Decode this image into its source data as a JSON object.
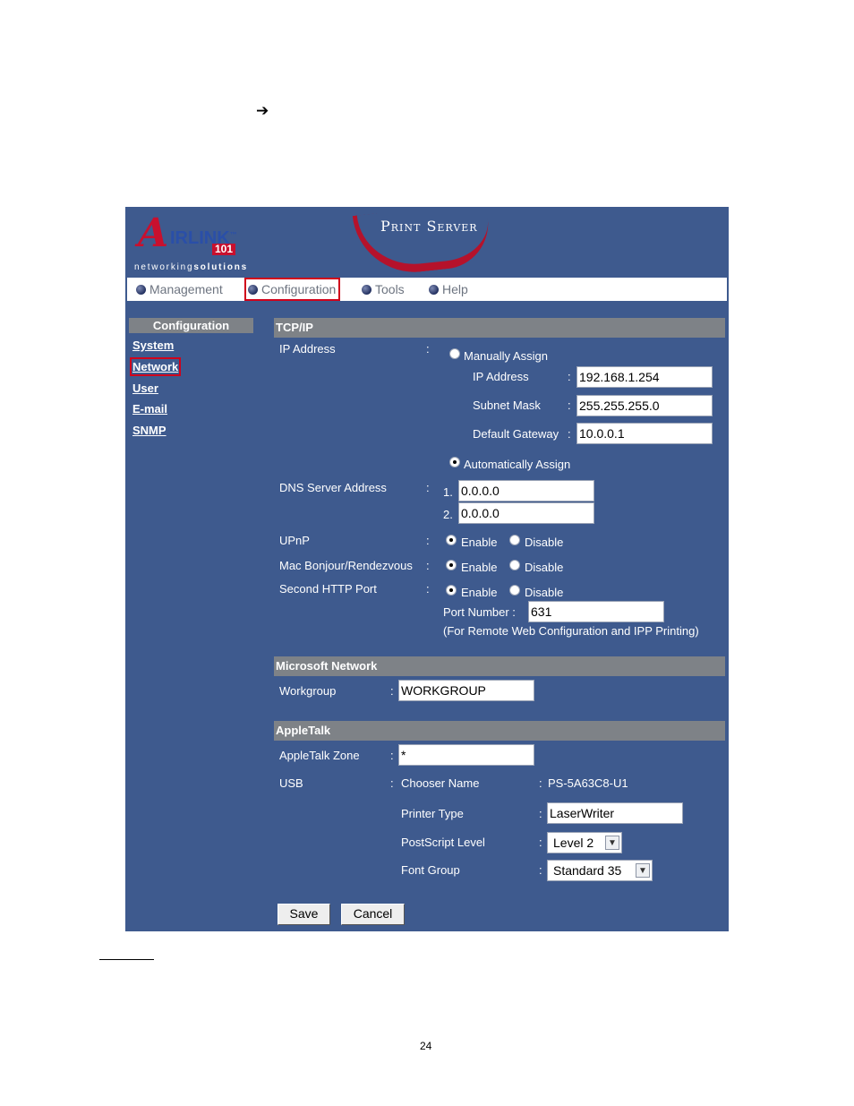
{
  "arrow": "➔",
  "brand": {
    "logo_a": "A",
    "logo_name": "IRLINK",
    "logo_tm": "™",
    "logo_num": "101",
    "tag_light": "networking",
    "tag_bold": "solutions",
    "product_title": "Print Server"
  },
  "nav": {
    "items": [
      {
        "label": "Management"
      },
      {
        "label": "Configuration"
      },
      {
        "label": "Tools"
      },
      {
        "label": "Help"
      }
    ]
  },
  "sidebar": {
    "heading": "Configuration",
    "items": [
      {
        "label": "System"
      },
      {
        "label": "Network"
      },
      {
        "label": "User"
      },
      {
        "label": "E-mail"
      },
      {
        "label": "SNMP"
      }
    ]
  },
  "tcpip": {
    "title": "TCP/IP",
    "ip_label": "IP Address",
    "manual_label": "Manually Assign",
    "manual_selected": false,
    "ip_field_label": "IP Address",
    "ip_value": "192.168.1.254",
    "mask_label": "Subnet Mask",
    "mask_value": "255.255.255.0",
    "gateway_label": "Default Gateway",
    "gateway_value": "10.0.0.1",
    "auto_label": "Automatically Assign",
    "auto_selected": true,
    "dns_label": "DNS Server Address",
    "dns1_index": "1.",
    "dns1_value": "0.0.0.0",
    "dns2_index": "2.",
    "dns2_value": "0.0.0.0",
    "upnp_label": "UPnP",
    "bonjour_label": "Mac Bonjour/Rendezvous",
    "http_label": "Second HTTP Port",
    "enable_label": "Enable",
    "disable_label": "Disable",
    "port_label": "Port Number :",
    "port_value": "631",
    "port_note": "(For Remote Web Configuration and IPP Printing)"
  },
  "microsoft": {
    "title": "Microsoft Network",
    "workgroup_label": "Workgroup",
    "workgroup_value": "WORKGROUP"
  },
  "appletalk": {
    "title": "AppleTalk",
    "zone_label": "AppleTalk Zone",
    "zone_value": "*",
    "usb_label": "USB",
    "chooser_label": "Chooser Name",
    "chooser_value": "PS-5A63C8-U1",
    "printer_type_label": "Printer Type",
    "printer_type_value": "LaserWriter",
    "postscript_label": "PostScript Level",
    "postscript_value": "Level 2",
    "font_group_label": "Font Group",
    "font_group_value": "Standard 35"
  },
  "buttons": {
    "save": "Save",
    "cancel": "Cancel"
  },
  "page_number": "24",
  "colors": {
    "panel_bg": "#3e5a8e",
    "section_bar": "#7e8287",
    "highlight": "#d0021b",
    "brand_red": "#c8102e"
  }
}
